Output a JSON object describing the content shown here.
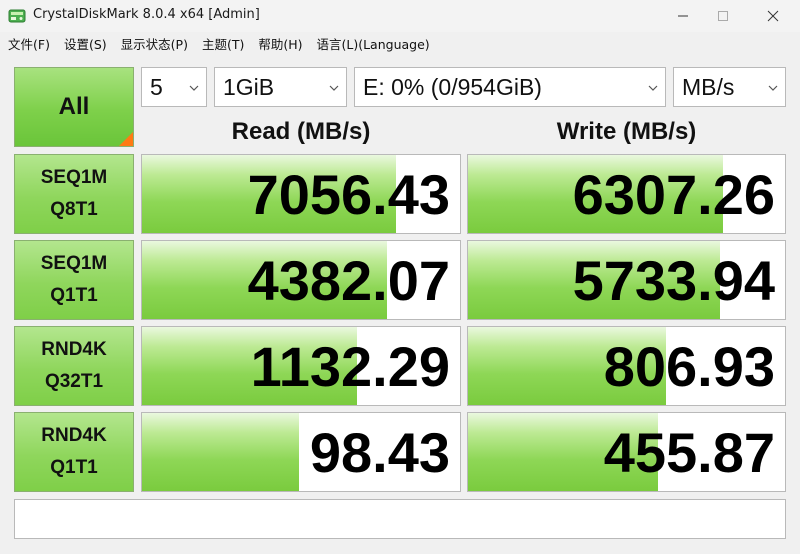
{
  "window": {
    "title": "CrystalDiskMark 8.0.4 x64 [Admin]",
    "minimize_icon": "minimize-icon",
    "maximize_icon": "maximize-icon",
    "close_icon": "close-icon"
  },
  "menu": [
    {
      "label": "文件(F)"
    },
    {
      "label": "设置(S)"
    },
    {
      "label": "显示状态(P)"
    },
    {
      "label": "主题(T)"
    },
    {
      "label": "帮助(H)"
    },
    {
      "label": "语言(L)(Language)"
    }
  ],
  "controls": {
    "all_label": "All",
    "count": "5",
    "size": "1GiB",
    "drive": "E: 0% (0/954GiB)",
    "unit": "MB/s"
  },
  "columns": {
    "read": "Read (MB/s)",
    "write": "Write (MB/s)"
  },
  "tests": [
    {
      "line1": "SEQ1M",
      "line2": "Q8T1",
      "read": "7056.43",
      "write": "6307.26",
      "read_fill": 0.8,
      "write_fill": 0.805
    },
    {
      "line1": "SEQ1M",
      "line2": "Q1T1",
      "read": "4382.07",
      "write": "5733.94",
      "read_fill": 0.77,
      "write_fill": 0.795
    },
    {
      "line1": "RND4K",
      "line2": "Q32T1",
      "read": "1132.29",
      "write": "806.93",
      "read_fill": 0.675,
      "write_fill": 0.625
    },
    {
      "line1": "RND4K",
      "line2": "Q1T1",
      "read": "98.43",
      "write": "455.87",
      "read_fill": 0.495,
      "write_fill": 0.6
    }
  ],
  "colors": {
    "accent_green": "#7ed04a",
    "corner_orange": "#ff7a14"
  },
  "status_text": ""
}
